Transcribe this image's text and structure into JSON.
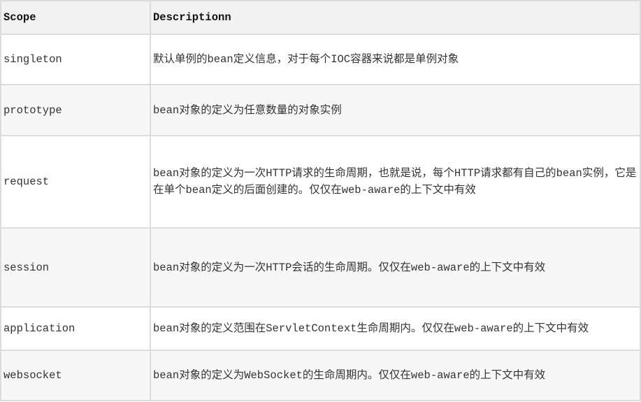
{
  "table": {
    "headers": [
      "Scope",
      "Descriptionn"
    ],
    "rows": [
      {
        "scope": "singleton",
        "description": "默认单例的bean定义信息，对于每个IOC容器来说都是单例对象"
      },
      {
        "scope": "prototype",
        "description": "bean对象的定义为任意数量的对象实例"
      },
      {
        "scope": "request",
        "description": "bean对象的定义为一次HTTP请求的生命周期，也就是说，每个HTTP请求都有自己的bean实例，它是在单个bean定义的后面创建的。仅仅在web-aware的上下文中有效"
      },
      {
        "scope": "session",
        "description": "bean对象的定义为一次HTTP会话的生命周期。仅仅在web-aware的上下文中有效"
      },
      {
        "scope": "application",
        "description": "bean对象的定义范围在ServletContext生命周期内。仅仅在web-aware的上下文中有效"
      },
      {
        "scope": "websocket",
        "description": "bean对象的定义为WebSocket的生命周期内。仅仅在web-aware的上下文中有效"
      }
    ]
  }
}
